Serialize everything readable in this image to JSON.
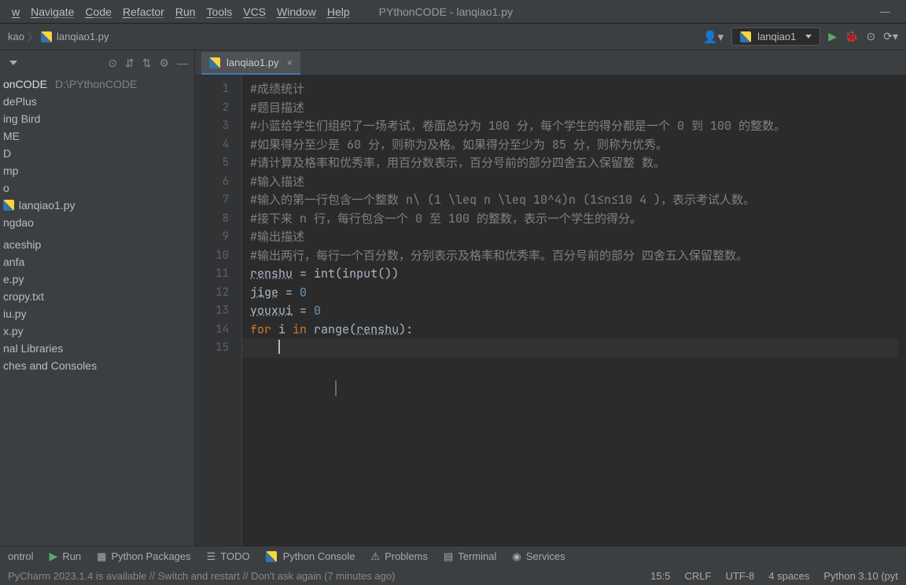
{
  "window": {
    "title": "PYthonCODE - lanqiao1.py",
    "minimize": "—"
  },
  "menu": [
    "w",
    "Navigate",
    "Code",
    "Refactor",
    "Run",
    "Tools",
    "VCS",
    "Window",
    "Help"
  ],
  "breadcrumb": {
    "item1": "kao",
    "item2": "lanqiao1.py"
  },
  "run_config": {
    "label": "lanqiao1"
  },
  "tree": {
    "root_name": "onCODE",
    "root_path": "D:\\PYthonCODE",
    "items": [
      "dePlus",
      "ing Bird",
      "ME",
      "D",
      "mp",
      "o",
      "lanqiao1.py",
      "ngdao",
      "",
      "aceship",
      "anfa",
      "e.py",
      "cropy.txt",
      "iu.py",
      "x.py",
      "nal Libraries",
      "ches and Consoles"
    ]
  },
  "tab": {
    "filename": "lanqiao1.py"
  },
  "code": {
    "lines": [
      "1",
      "2",
      "3",
      "4",
      "5",
      "6",
      "7",
      "8",
      "9",
      "10",
      "11",
      "12",
      "13",
      "14",
      "15"
    ],
    "l1": "#成绩统计",
    "l2": "#题目描述",
    "l3": "#小蓝给学生们组织了一场考试，卷面总分为 100 分，每个学生的得分都是一个 0 到 100 的整数。",
    "l4": "#如果得分至少是 60 分，则称为及格。如果得分至少为 85 分，则称为优秀。",
    "l5": "#请计算及格率和优秀率，用百分数表示，百分号前的部分四舍五入保留整 数。",
    "l6": "#输入描述",
    "l7": "#输入的第一行包含一个整数 n\\ (1 \\leq n \\leq 10^4)n (1≤n≤10 4 )，表示考试人数。",
    "l8": "#接下来 n 行，每行包含一个 0 至 100 的整数，表示一个学生的得分。",
    "l9": "#输出描述",
    "l10": "#输出两行，每行一个百分数，分别表示及格率和优秀率。百分号前的部分 四舍五入保留整数。",
    "l11_var": "renshu",
    "l11_eq": " = ",
    "l11_fn": "int",
    "l11_p1": "(",
    "l11_fn2": "input",
    "l11_p2": "())",
    "l12_var": "jige",
    "l12_rest": " = ",
    "l12_num": "0",
    "l13_var": "youxui",
    "l13_rest": " = ",
    "l13_num": "0",
    "l14_for": "for ",
    "l14_i": "i ",
    "l14_in": "in ",
    "l14_range": "range(",
    "l14_var": "renshu",
    "l14_end": "):"
  },
  "bottom": {
    "control": "ontrol",
    "run": "Run",
    "packages": "Python Packages",
    "todo": "TODO",
    "console": "Python Console",
    "problems": "Problems",
    "terminal": "Terminal",
    "services": "Services"
  },
  "status": {
    "message": "PyCharm 2023.1.4 is available // Switch and restart // Don't ask again (7 minutes ago)",
    "pos": "15:5",
    "sep": "CRLF",
    "enc": "UTF-8",
    "indent": "4 spaces",
    "python": "Python 3.10 (pyt"
  }
}
